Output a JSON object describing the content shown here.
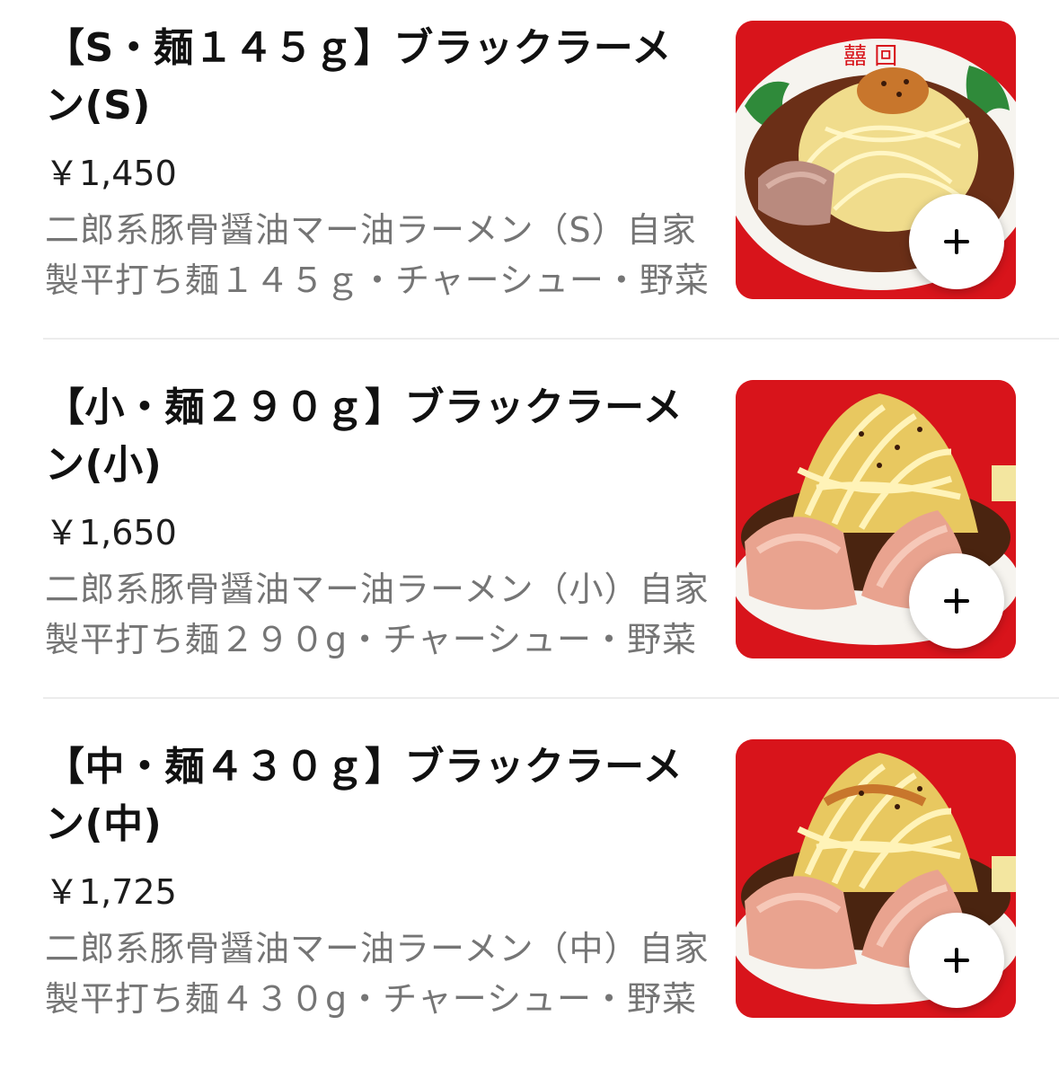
{
  "menu": {
    "items": [
      {
        "name": "【S・麺１４５ｇ】ブラックラーメン(S)",
        "price": "￥1,450",
        "description": "二郎系豚骨醤油マー油ラーメン（S）自家製平打ち麺１４５ｇ・チャーシュー・野菜",
        "photo_icon": "ramen-bowl-photo",
        "add_icon": "plus-icon"
      },
      {
        "name": "【小・麺２９０ｇ】ブラックラーメン(小)",
        "price": "￥1,650",
        "description": "二郎系豚骨醤油マー油ラーメン（小）自家製平打ち麺２９０g・チャーシュー・野菜",
        "photo_icon": "ramen-bowl-photo",
        "add_icon": "plus-icon"
      },
      {
        "name": "【中・麺４３０ｇ】ブラックラーメン(中)",
        "price": "￥1,725",
        "description": "二郎系豚骨醤油マー油ラーメン（中）自家製平打ち麺４３０g・チャーシュー・野菜",
        "photo_icon": "ramen-bowl-photo",
        "add_icon": "plus-icon"
      }
    ]
  },
  "colors": {
    "photo_background": "#d8141b",
    "description_text": "#757575",
    "divider": "#ececec",
    "add_button_background": "#ffffff"
  }
}
